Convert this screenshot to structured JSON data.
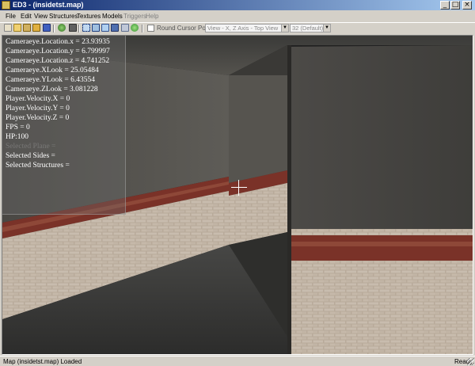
{
  "window": {
    "title": "ED3 - (insidetst.map)",
    "min_glyph": "_",
    "max_glyph": "□",
    "close_glyph": "×",
    "app_icon": "editor-app-icon"
  },
  "menu": {
    "items": [
      "File",
      "Edit",
      "View",
      "Structures",
      "Textures",
      "Models",
      "Triggers",
      "Help"
    ]
  },
  "toolbar": {
    "buttons": [
      "new-icon",
      "open-icon",
      "save-icon",
      "texture-icon",
      "model-icon",
      "cube-icon",
      "box-icon",
      "select-icon",
      "move-icon",
      "rotate-icon",
      "scale-icon",
      "grid-icon",
      "settings-icon"
    ],
    "round_cursor_label": "Round Cursor Position",
    "round_cursor_checked": false,
    "view_select": "View - X, Z Axis - Top View",
    "grid_select": "32 (Default)"
  },
  "viewport": {
    "overlay_lines": [
      "Cameraeye.Location.x = 23.93935",
      "Cameraeye.Location.y = 6.799997",
      "Cameraeye.Location.z = 4.741252",
      "Cameraeye.XLook = 25.05484",
      "Cameraeye.YLook = 6.43554",
      "Cameraeye.ZLook = 3.081228",
      "Player.Velocity.X = 0",
      "Player.Velocity.Y = 0",
      "Player.Velocity.Z = 0",
      "FPS = 0",
      "HP:100",
      "Selected Plane =",
      "Selected Sides =",
      "Selected Structures ="
    ]
  },
  "status": {
    "left": "Map (insidetst.map) Loaded",
    "right": "Ready"
  },
  "colors": {
    "title_start": "#0a246a",
    "title_end": "#a6caf0",
    "chrome": "#d4d0c8",
    "brick_stripe": "#7a3228"
  }
}
